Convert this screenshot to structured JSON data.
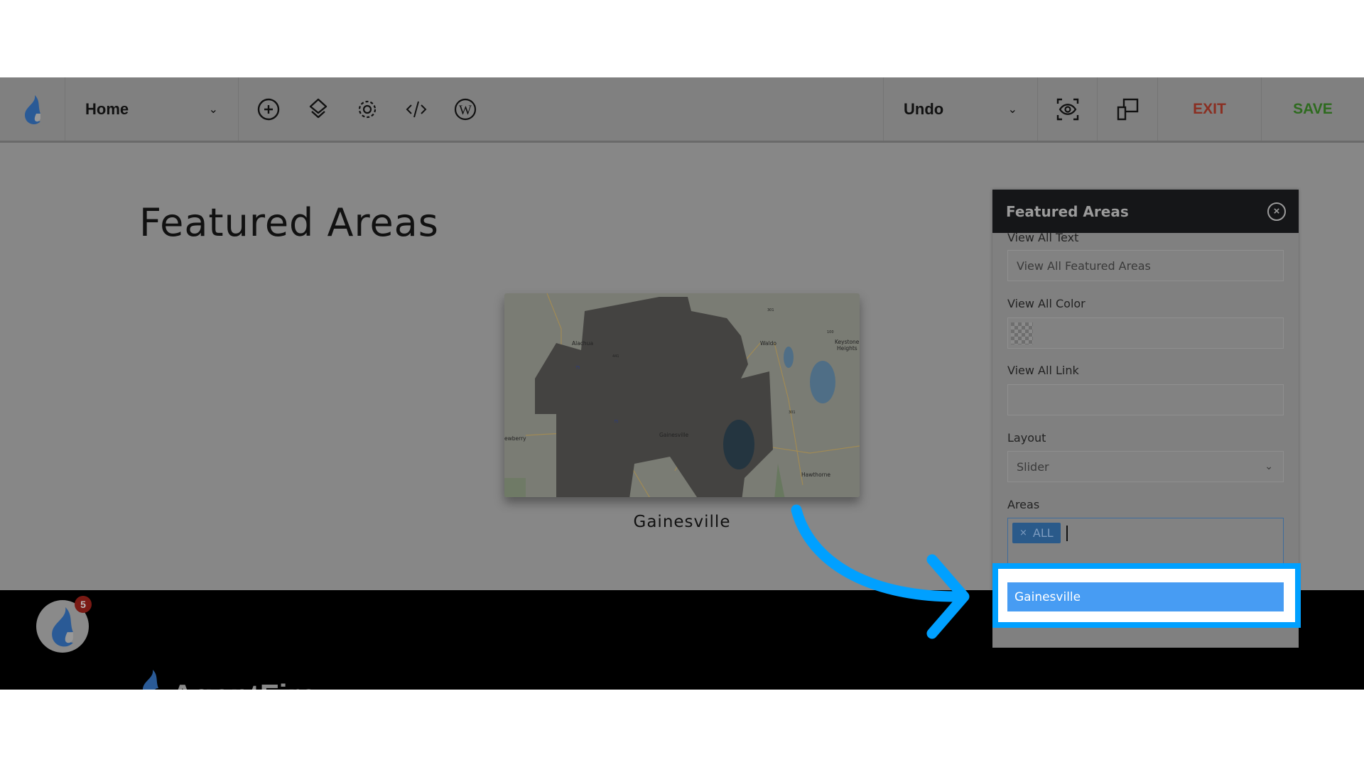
{
  "toolbar": {
    "page_select": "Home",
    "undo_label": "Undo",
    "exit_label": "EXIT",
    "save_label": "SAVE",
    "exit_color": "#8a2f22",
    "save_color": "#2e6b1f",
    "icons": [
      "flame-logo-icon",
      "add-circle-icon",
      "layers-icon",
      "gear-icon",
      "code-icon",
      "wordpress-icon",
      "preview-eye-icon",
      "responsive-devices-icon"
    ]
  },
  "page": {
    "title": "Featured Areas",
    "area_caption": "Gainesville",
    "map_labels": [
      "Alachua",
      "Waldo",
      "Keystone",
      "Heights",
      "Gainesville",
      "ewberry",
      "Hawthorne",
      "441",
      "301",
      "301",
      "100",
      "75",
      "75"
    ]
  },
  "panel": {
    "title": "Featured Areas",
    "view_all_text_label": "View All Text",
    "view_all_text_value": "View All Featured Areas",
    "view_all_color_label": "View All Color",
    "view_all_link_label": "View All Link",
    "view_all_link_value": "",
    "layout_label": "Layout",
    "layout_value": "Slider",
    "areas_label": "Areas",
    "areas_tags": [
      "ALL"
    ],
    "dropdown_options": [
      "Gainesville"
    ]
  },
  "footer": {
    "notification_count": "5",
    "brand": "AgentFire"
  },
  "annotation_color": "#00a0ff"
}
